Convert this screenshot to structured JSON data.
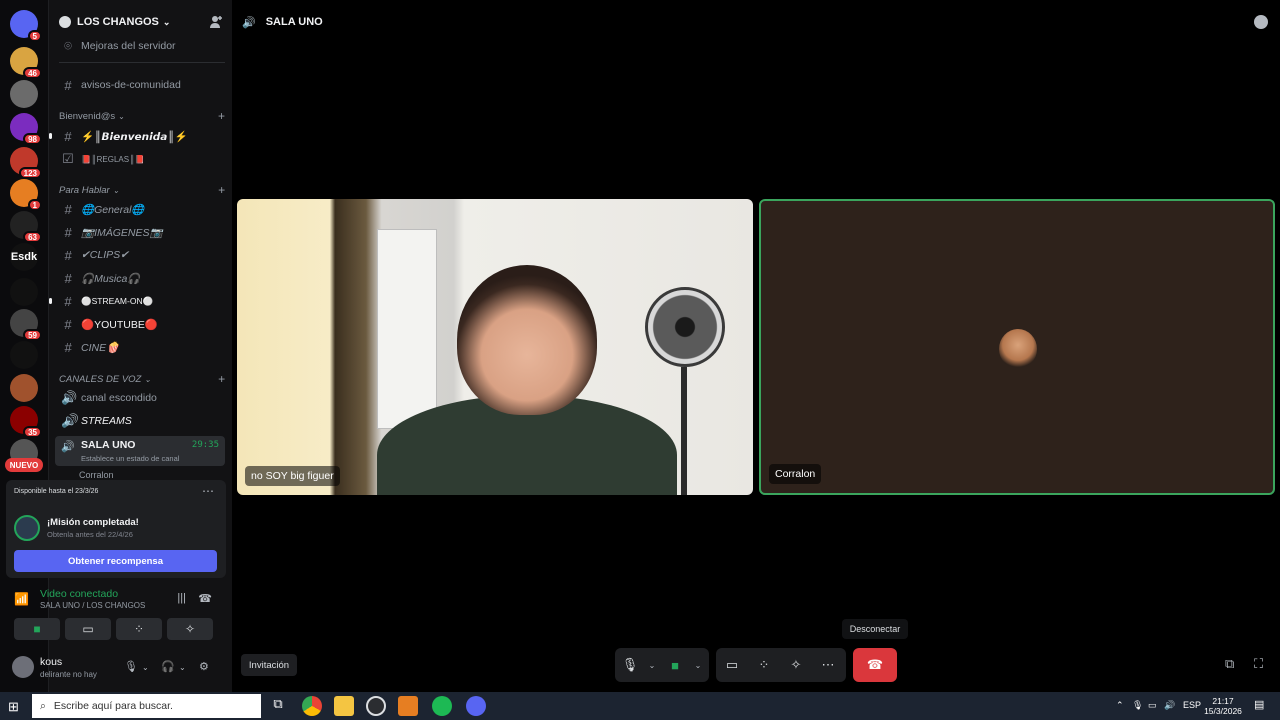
{
  "server": {
    "name": "LOS CHANGOS",
    "rail": [
      {
        "icon": "discord-home-icon",
        "badge": "5",
        "color": "#5865f2"
      },
      {
        "icon": "server-icon",
        "badge": "46",
        "color": "#d9a441"
      },
      {
        "icon": "server-icon",
        "badge": "",
        "color": "#6b6b6b"
      },
      {
        "icon": "server-icon",
        "badge": "98",
        "color": "#7b2cbf"
      },
      {
        "icon": "server-icon",
        "badge": "123",
        "color": "#c0392b"
      },
      {
        "icon": "server-icon",
        "badge": "1",
        "color": "#e67e22"
      },
      {
        "icon": "server-icon",
        "badge": "63",
        "color": "#222"
      },
      {
        "icon": "server-text-icon",
        "badge": "",
        "color": "#111",
        "text": "Esdk"
      },
      {
        "icon": "server-icon",
        "badge": "",
        "color": "#111"
      },
      {
        "icon": "server-icon",
        "badge": "59",
        "color": "#444"
      },
      {
        "icon": "server-icon",
        "badge": "",
        "color": "#111"
      },
      {
        "icon": "server-icon",
        "badge": "",
        "color": "#a0522d"
      },
      {
        "icon": "server-icon",
        "badge": "35",
        "color": "#8b0000"
      },
      {
        "icon": "server-icon",
        "badge": "",
        "color": "#555"
      }
    ],
    "nuevo": "NUEVO"
  },
  "channels": {
    "boost": "Mejoras del servidor",
    "announce": "avisos-de-comunidad",
    "cat_welcome": "Bienvenid@s",
    "welcome": "⚡║𝘽𝙞𝙚𝙣𝙫𝙚𝙣𝙞𝙙𝙖║⚡",
    "rules": "📕║REGLAS║📕",
    "cat_talk": "Para Hablar",
    "general": "🌐General🌐",
    "images": "📷IMÁGENES📷",
    "clips": "✔CLIPS✔",
    "music": "🎧Musica🎧",
    "stream": "⚪STREAM-ON⚪",
    "youtube": "🔴YOUTUBE🔴",
    "cine": "CINE🍿",
    "cat_voice": "CANALES DE VOZ",
    "hidden": "canal escondido",
    "streams": "STREAMS",
    "sala_uno": "SALA UNO",
    "timer": "29:35",
    "set_status": "Establece un estado de canal",
    "partial_user": "Corralon"
  },
  "quest": {
    "available_until": "Disponible hasta el 23/3/26",
    "title": "¡Misión completada!",
    "subtitle": "Obtenla antes del 22/4/26",
    "button": "Obtener recompensa"
  },
  "voice": {
    "title": "Video conectado",
    "subtitle": "SALA UNO  / LOS CHANGOS"
  },
  "user": {
    "name": "kous",
    "status": "delirante no hay"
  },
  "topbar": {
    "channel": "SALA UNO"
  },
  "stage": {
    "tile1_label": "no SOY big figuer",
    "tile2_label": "Corralon",
    "tooltip": "Desconectar",
    "invite": "Invitación"
  },
  "taskbar": {
    "search_placeholder": "Escribe aquí para buscar.",
    "lang": "ESP",
    "time": "21:17",
    "date": "15/3/2026"
  },
  "colors": {
    "accent": "#5865f2",
    "online": "#23a55a",
    "danger": "#da373c"
  }
}
